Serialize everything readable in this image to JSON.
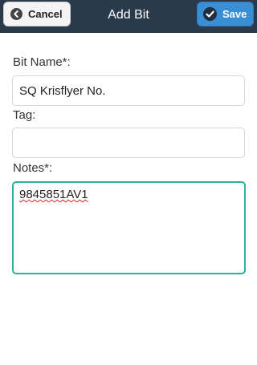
{
  "header": {
    "title": "Add Bit",
    "cancel_label": "Cancel",
    "save_label": "Save",
    "background_color": "#2b3a4b",
    "save_color": "#3a8ed3"
  },
  "form": {
    "bit_name": {
      "label": "Bit Name*:",
      "value": "SQ Krisflyer No."
    },
    "tag": {
      "label": "Tag:",
      "value": ""
    },
    "notes": {
      "label": "Notes*:",
      "value": "9845851AV1",
      "focus_color": "#2ab39a"
    }
  }
}
